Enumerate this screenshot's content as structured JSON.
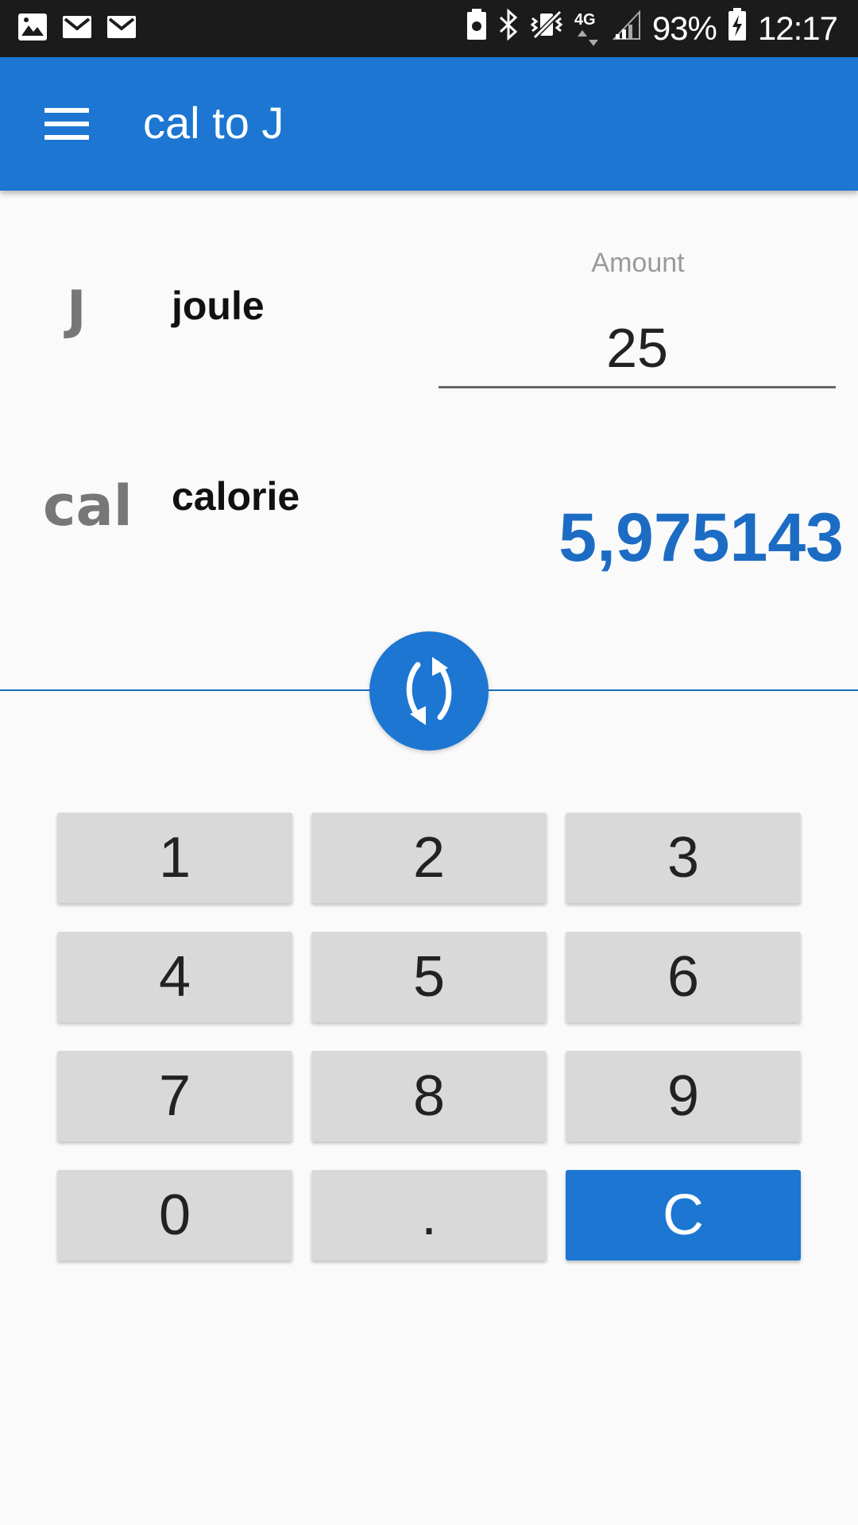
{
  "status_bar": {
    "battery_percent": "93%",
    "time": "12:17",
    "network": "4G",
    "icons": [
      "gallery-icon",
      "mail-icon",
      "mail-icon",
      "battery-saver-icon",
      "bluetooth-icon",
      "vibrate-icon",
      "signal-icon",
      "battery-charging-icon"
    ]
  },
  "app_bar": {
    "title": "cal to J",
    "menu_icon": "hamburger-menu-icon"
  },
  "converter": {
    "from_unit": {
      "symbol": "J",
      "name": "joule"
    },
    "to_unit": {
      "symbol": "cal",
      "name": "calorie"
    },
    "amount_label": "Amount",
    "amount_value": "25",
    "result": "5,975143",
    "swap_icon": "swap-arrows-icon"
  },
  "keypad": {
    "keys": [
      "1",
      "2",
      "3",
      "4",
      "5",
      "6",
      "7",
      "8",
      "9",
      "0",
      ".",
      "C"
    ]
  },
  "colors": {
    "primary": "#1c76d2",
    "result_text": "#1c6cc4",
    "status_bar": "#1b1b1b",
    "key_background": "#d9d9d9",
    "background": "#fafafa"
  }
}
